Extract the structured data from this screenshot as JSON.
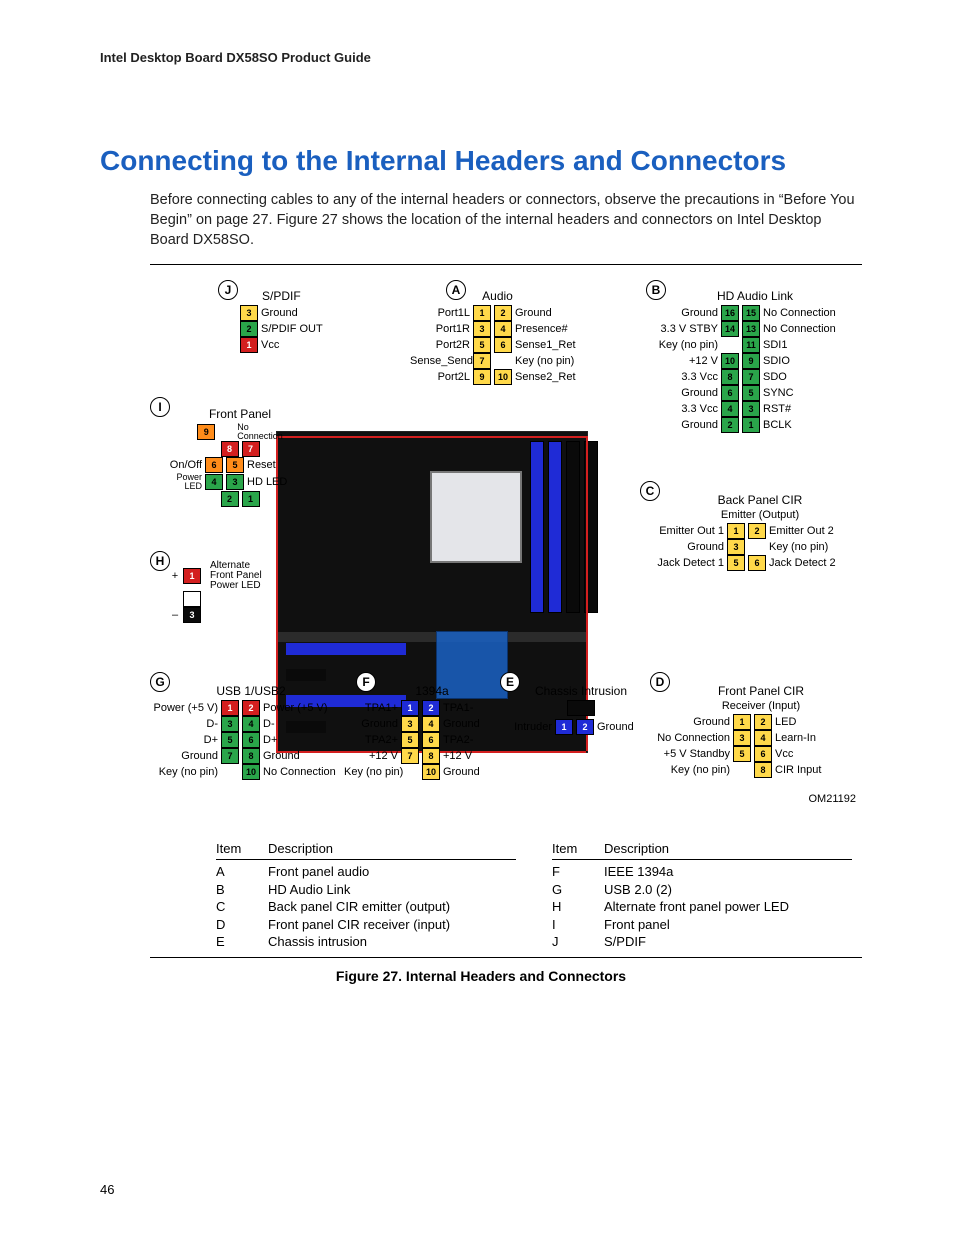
{
  "running_header": "Intel Desktop Board DX58SO Product Guide",
  "page_number": "46",
  "title": "Connecting to the Internal Headers and Connectors",
  "intro": "Before connecting cables to any of the internal headers or connectors, observe the precautions in “Before You Begin” on page 27.  Figure 27 shows the location of the internal headers and connectors on Intel Desktop Board DX58SO.",
  "figure_caption": "Figure 27.  Internal Headers and Connectors",
  "om_code": "OM21192",
  "bubbles": {
    "A": "A",
    "B": "B",
    "C": "C",
    "D": "D",
    "E": "E",
    "F": "F",
    "G": "G",
    "H": "H",
    "I": "I",
    "J": "J"
  },
  "headers": {
    "J": {
      "title": "S/PDIF",
      "pins": [
        {
          "n": "3",
          "cls": "y",
          "label": "Ground"
        },
        {
          "n": "2",
          "cls": "g",
          "label": "S/PDIF OUT"
        },
        {
          "n": "1",
          "cls": "r",
          "label": "Vcc"
        }
      ]
    },
    "A": {
      "title": "Audio",
      "rows": [
        {
          "l": "Port1L",
          "p1": {
            "n": "1",
            "cls": "y"
          },
          "p2": {
            "n": "2",
            "cls": "y"
          },
          "r": "Ground"
        },
        {
          "l": "Port1R",
          "p1": {
            "n": "3",
            "cls": "y"
          },
          "p2": {
            "n": "4",
            "cls": "y"
          },
          "r": "Presence#"
        },
        {
          "l": "Port2R",
          "p1": {
            "n": "5",
            "cls": "y"
          },
          "p2": {
            "n": "6",
            "cls": "y"
          },
          "r": "Sense1_Ret"
        },
        {
          "l": "Sense_Send",
          "p1": {
            "n": "7",
            "cls": "y"
          },
          "p2": null,
          "r": "Key (no pin)"
        },
        {
          "l": "Port2L",
          "p1": {
            "n": "9",
            "cls": "y"
          },
          "p2": {
            "n": "10",
            "cls": "y"
          },
          "r": "Sense2_Ret"
        }
      ]
    },
    "B": {
      "title": "HD Audio Link",
      "rows": [
        {
          "l": "Ground",
          "p1": {
            "n": "16",
            "cls": "g"
          },
          "p2": {
            "n": "15",
            "cls": "g"
          },
          "r": "No Connection"
        },
        {
          "l": "3.3 V STBY",
          "p1": {
            "n": "14",
            "cls": "g"
          },
          "p2": {
            "n": "13",
            "cls": "g"
          },
          "r": "No Connection"
        },
        {
          "l": "Key (no pin)",
          "p1": null,
          "p2": {
            "n": "11",
            "cls": "g"
          },
          "r": "SDI1"
        },
        {
          "l": "+12 V",
          "p1": {
            "n": "10",
            "cls": "g"
          },
          "p2": {
            "n": "9",
            "cls": "g"
          },
          "r": "SDIO"
        },
        {
          "l": "3.3 Vcc",
          "p1": {
            "n": "8",
            "cls": "g"
          },
          "p2": {
            "n": "7",
            "cls": "g"
          },
          "r": "SDO"
        },
        {
          "l": "Ground",
          "p1": {
            "n": "6",
            "cls": "g"
          },
          "p2": {
            "n": "5",
            "cls": "g"
          },
          "r": "SYNC"
        },
        {
          "l": "3.3 Vcc",
          "p1": {
            "n": "4",
            "cls": "g"
          },
          "p2": {
            "n": "3",
            "cls": "g"
          },
          "r": "RST#"
        },
        {
          "l": "Ground",
          "p1": {
            "n": "2",
            "cls": "g"
          },
          "p2": {
            "n": "1",
            "cls": "g"
          },
          "r": "BCLK"
        }
      ]
    },
    "C": {
      "title": "Back Panel CIR",
      "subtitle": "Emitter (Output)",
      "rows": [
        {
          "l": "Emitter Out 1",
          "p1": {
            "n": "1",
            "cls": "y"
          },
          "p2": {
            "n": "2",
            "cls": "y"
          },
          "r": "Emitter Out 2"
        },
        {
          "l": "Ground",
          "p1": {
            "n": "3",
            "cls": "y"
          },
          "p2": null,
          "r": "Key (no pin)"
        },
        {
          "l": "Jack Detect 1",
          "p1": {
            "n": "5",
            "cls": "y"
          },
          "p2": {
            "n": "6",
            "cls": "y"
          },
          "r": "Jack Detect 2"
        }
      ]
    },
    "D": {
      "title": "Front Panel CIR",
      "subtitle": "Receiver (Input)",
      "rows": [
        {
          "l": "Ground",
          "p1": {
            "n": "1",
            "cls": "y"
          },
          "p2": {
            "n": "2",
            "cls": "y"
          },
          "r": "LED"
        },
        {
          "l": "No Connection",
          "p1": {
            "n": "3",
            "cls": "y"
          },
          "p2": {
            "n": "4",
            "cls": "y"
          },
          "r": "Learn-In"
        },
        {
          "l": "+5 V Standby",
          "p1": {
            "n": "5",
            "cls": "y"
          },
          "p2": {
            "n": "6",
            "cls": "y"
          },
          "r": "Vcc"
        },
        {
          "l": "Key (no pin)",
          "p1": null,
          "p2": {
            "n": "8",
            "cls": "y"
          },
          "r": "CIR Input"
        }
      ]
    },
    "E": {
      "title": "Chassis Intrusion",
      "rows": [
        {
          "l": "Intruder",
          "p1": {
            "n": "1",
            "cls": "b"
          },
          "p2": {
            "n": "2",
            "cls": "b"
          },
          "r": "Ground"
        }
      ]
    },
    "F": {
      "title": "1394a",
      "rows": [
        {
          "l": "TPA1+",
          "p1": {
            "n": "1",
            "cls": "b"
          },
          "p2": {
            "n": "2",
            "cls": "b"
          },
          "r": "TPA1-"
        },
        {
          "l": "Ground",
          "p1": {
            "n": "3",
            "cls": "y"
          },
          "p2": {
            "n": "4",
            "cls": "y"
          },
          "r": "Ground"
        },
        {
          "l": "TPA2+",
          "p1": {
            "n": "5",
            "cls": "y"
          },
          "p2": {
            "n": "6",
            "cls": "y"
          },
          "r": "TPA2-"
        },
        {
          "l": "+12 V",
          "p1": {
            "n": "7",
            "cls": "y"
          },
          "p2": {
            "n": "8",
            "cls": "y"
          },
          "r": "+12 V"
        },
        {
          "l": "Key (no pin)",
          "p1": null,
          "p2": {
            "n": "10",
            "cls": "y"
          },
          "r": "Ground"
        }
      ],
      "key_label": "Key\n(no pin)"
    },
    "G": {
      "title": "USB 1/USB2",
      "rows": [
        {
          "l": "Power (+5 V)",
          "p1": {
            "n": "1",
            "cls": "r"
          },
          "p2": {
            "n": "2",
            "cls": "r"
          },
          "r": "Power (+5 V)"
        },
        {
          "l": "D-",
          "p1": {
            "n": "3",
            "cls": "g"
          },
          "p2": {
            "n": "4",
            "cls": "g"
          },
          "r": "D-"
        },
        {
          "l": "D+",
          "p1": {
            "n": "5",
            "cls": "g"
          },
          "p2": {
            "n": "6",
            "cls": "g"
          },
          "r": "D+"
        },
        {
          "l": "Ground",
          "p1": {
            "n": "7",
            "cls": "g"
          },
          "p2": {
            "n": "8",
            "cls": "g"
          },
          "r": "Ground"
        },
        {
          "l": "Key (no pin)",
          "p1": null,
          "p2": {
            "n": "10",
            "cls": "g"
          },
          "r": "No Connection"
        }
      ]
    },
    "H": {
      "title": "Alternate Front Panel Power LED",
      "pins": [
        {
          "sym": "+",
          "n": "1",
          "cls": "r"
        },
        {
          "sym": "",
          "n": "",
          "cls": ""
        },
        {
          "sym": "–",
          "n": "3",
          "cls": "k"
        }
      ],
      "label_text": "Alternate\nFront Panel\nPower LED"
    },
    "I": {
      "title": "Front Panel",
      "rows": [
        {
          "l": "",
          "p1": {
            "n": "9",
            "cls": "o"
          },
          "p2": null,
          "r": "No Connection"
        },
        {
          "l": "",
          "p1": {
            "n": "8",
            "cls": "r"
          },
          "p2": {
            "n": "7",
            "cls": "r"
          },
          "r": ""
        },
        {
          "l": "On/Off",
          "p1": {
            "n": "6",
            "cls": "o"
          },
          "p2": {
            "n": "5",
            "cls": "o"
          },
          "r": "Reset"
        },
        {
          "l": "Power LED",
          "p1": {
            "n": "4",
            "cls": "g"
          },
          "p2": {
            "n": "3",
            "cls": "g"
          },
          "r": "HD LED"
        },
        {
          "l": "",
          "p1": {
            "n": "2",
            "cls": "g"
          },
          "p2": {
            "n": "1",
            "cls": "g"
          },
          "r": ""
        }
      ],
      "onoff_label": "On/Off",
      "reset_label": "Reset",
      "powerled_label": "Power\nLED",
      "hdled_label": "HD LED",
      "noconn_label": "No\nConnection"
    }
  },
  "legend": {
    "col1_head": {
      "item": "Item",
      "desc": "Description"
    },
    "col2_head": {
      "item": "Item",
      "desc": "Description"
    },
    "col1": [
      {
        "item": "A",
        "desc": "Front panel audio"
      },
      {
        "item": "B",
        "desc": "HD Audio Link"
      },
      {
        "item": "C",
        "desc": "Back panel CIR emitter (output)"
      },
      {
        "item": "D",
        "desc": "Front panel CIR receiver (input)"
      },
      {
        "item": "E",
        "desc": "Chassis intrusion"
      }
    ],
    "col2": [
      {
        "item": "F",
        "desc": "IEEE 1394a"
      },
      {
        "item": "G",
        "desc": "USB 2.0 (2)"
      },
      {
        "item": "H",
        "desc": "Alternate front panel power LED"
      },
      {
        "item": "I",
        "desc": "Front panel"
      },
      {
        "item": "J",
        "desc": "S/PDIF"
      }
    ]
  }
}
